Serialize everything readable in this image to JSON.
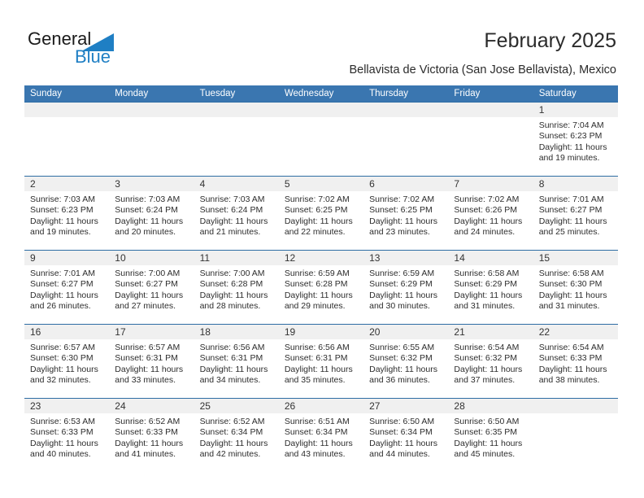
{
  "brand": {
    "word_one": "General",
    "word_two": "Blue",
    "triangle_color": "#1f7fc4",
    "accent_color": "#1f7fc4"
  },
  "header": {
    "title": "February 2025",
    "subtitle": "Bellavista de Victoria (San Jose Bellavista), Mexico"
  },
  "theme": {
    "header_blue": "#3a76b0",
    "row_line_blue": "#2e6da4",
    "daynum_band": "#f0f0f0",
    "text": "#2d2d2d"
  },
  "calendar": {
    "weekday_headers": [
      "Sunday",
      "Monday",
      "Tuesday",
      "Wednesday",
      "Thursday",
      "Friday",
      "Saturday"
    ],
    "weeks": [
      [
        {
          "day": "",
          "sunrise": "",
          "sunset": "",
          "daylight": ""
        },
        {
          "day": "",
          "sunrise": "",
          "sunset": "",
          "daylight": ""
        },
        {
          "day": "",
          "sunrise": "",
          "sunset": "",
          "daylight": ""
        },
        {
          "day": "",
          "sunrise": "",
          "sunset": "",
          "daylight": ""
        },
        {
          "day": "",
          "sunrise": "",
          "sunset": "",
          "daylight": ""
        },
        {
          "day": "",
          "sunrise": "",
          "sunset": "",
          "daylight": ""
        },
        {
          "day": "1",
          "sunrise": "Sunrise: 7:04 AM",
          "sunset": "Sunset: 6:23 PM",
          "daylight": "Daylight: 11 hours and 19 minutes."
        }
      ],
      [
        {
          "day": "2",
          "sunrise": "Sunrise: 7:03 AM",
          "sunset": "Sunset: 6:23 PM",
          "daylight": "Daylight: 11 hours and 19 minutes."
        },
        {
          "day": "3",
          "sunrise": "Sunrise: 7:03 AM",
          "sunset": "Sunset: 6:24 PM",
          "daylight": "Daylight: 11 hours and 20 minutes."
        },
        {
          "day": "4",
          "sunrise": "Sunrise: 7:03 AM",
          "sunset": "Sunset: 6:24 PM",
          "daylight": "Daylight: 11 hours and 21 minutes."
        },
        {
          "day": "5",
          "sunrise": "Sunrise: 7:02 AM",
          "sunset": "Sunset: 6:25 PM",
          "daylight": "Daylight: 11 hours and 22 minutes."
        },
        {
          "day": "6",
          "sunrise": "Sunrise: 7:02 AM",
          "sunset": "Sunset: 6:25 PM",
          "daylight": "Daylight: 11 hours and 23 minutes."
        },
        {
          "day": "7",
          "sunrise": "Sunrise: 7:02 AM",
          "sunset": "Sunset: 6:26 PM",
          "daylight": "Daylight: 11 hours and 24 minutes."
        },
        {
          "day": "8",
          "sunrise": "Sunrise: 7:01 AM",
          "sunset": "Sunset: 6:27 PM",
          "daylight": "Daylight: 11 hours and 25 minutes."
        }
      ],
      [
        {
          "day": "9",
          "sunrise": "Sunrise: 7:01 AM",
          "sunset": "Sunset: 6:27 PM",
          "daylight": "Daylight: 11 hours and 26 minutes."
        },
        {
          "day": "10",
          "sunrise": "Sunrise: 7:00 AM",
          "sunset": "Sunset: 6:27 PM",
          "daylight": "Daylight: 11 hours and 27 minutes."
        },
        {
          "day": "11",
          "sunrise": "Sunrise: 7:00 AM",
          "sunset": "Sunset: 6:28 PM",
          "daylight": "Daylight: 11 hours and 28 minutes."
        },
        {
          "day": "12",
          "sunrise": "Sunrise: 6:59 AM",
          "sunset": "Sunset: 6:28 PM",
          "daylight": "Daylight: 11 hours and 29 minutes."
        },
        {
          "day": "13",
          "sunrise": "Sunrise: 6:59 AM",
          "sunset": "Sunset: 6:29 PM",
          "daylight": "Daylight: 11 hours and 30 minutes."
        },
        {
          "day": "14",
          "sunrise": "Sunrise: 6:58 AM",
          "sunset": "Sunset: 6:29 PM",
          "daylight": "Daylight: 11 hours and 31 minutes."
        },
        {
          "day": "15",
          "sunrise": "Sunrise: 6:58 AM",
          "sunset": "Sunset: 6:30 PM",
          "daylight": "Daylight: 11 hours and 31 minutes."
        }
      ],
      [
        {
          "day": "16",
          "sunrise": "Sunrise: 6:57 AM",
          "sunset": "Sunset: 6:30 PM",
          "daylight": "Daylight: 11 hours and 32 minutes."
        },
        {
          "day": "17",
          "sunrise": "Sunrise: 6:57 AM",
          "sunset": "Sunset: 6:31 PM",
          "daylight": "Daylight: 11 hours and 33 minutes."
        },
        {
          "day": "18",
          "sunrise": "Sunrise: 6:56 AM",
          "sunset": "Sunset: 6:31 PM",
          "daylight": "Daylight: 11 hours and 34 minutes."
        },
        {
          "day": "19",
          "sunrise": "Sunrise: 6:56 AM",
          "sunset": "Sunset: 6:31 PM",
          "daylight": "Daylight: 11 hours and 35 minutes."
        },
        {
          "day": "20",
          "sunrise": "Sunrise: 6:55 AM",
          "sunset": "Sunset: 6:32 PM",
          "daylight": "Daylight: 11 hours and 36 minutes."
        },
        {
          "day": "21",
          "sunrise": "Sunrise: 6:54 AM",
          "sunset": "Sunset: 6:32 PM",
          "daylight": "Daylight: 11 hours and 37 minutes."
        },
        {
          "day": "22",
          "sunrise": "Sunrise: 6:54 AM",
          "sunset": "Sunset: 6:33 PM",
          "daylight": "Daylight: 11 hours and 38 minutes."
        }
      ],
      [
        {
          "day": "23",
          "sunrise": "Sunrise: 6:53 AM",
          "sunset": "Sunset: 6:33 PM",
          "daylight": "Daylight: 11 hours and 40 minutes."
        },
        {
          "day": "24",
          "sunrise": "Sunrise: 6:52 AM",
          "sunset": "Sunset: 6:33 PM",
          "daylight": "Daylight: 11 hours and 41 minutes."
        },
        {
          "day": "25",
          "sunrise": "Sunrise: 6:52 AM",
          "sunset": "Sunset: 6:34 PM",
          "daylight": "Daylight: 11 hours and 42 minutes."
        },
        {
          "day": "26",
          "sunrise": "Sunrise: 6:51 AM",
          "sunset": "Sunset: 6:34 PM",
          "daylight": "Daylight: 11 hours and 43 minutes."
        },
        {
          "day": "27",
          "sunrise": "Sunrise: 6:50 AM",
          "sunset": "Sunset: 6:34 PM",
          "daylight": "Daylight: 11 hours and 44 minutes."
        },
        {
          "day": "28",
          "sunrise": "Sunrise: 6:50 AM",
          "sunset": "Sunset: 6:35 PM",
          "daylight": "Daylight: 11 hours and 45 minutes."
        },
        {
          "day": "",
          "sunrise": "",
          "sunset": "",
          "daylight": ""
        }
      ]
    ]
  }
}
